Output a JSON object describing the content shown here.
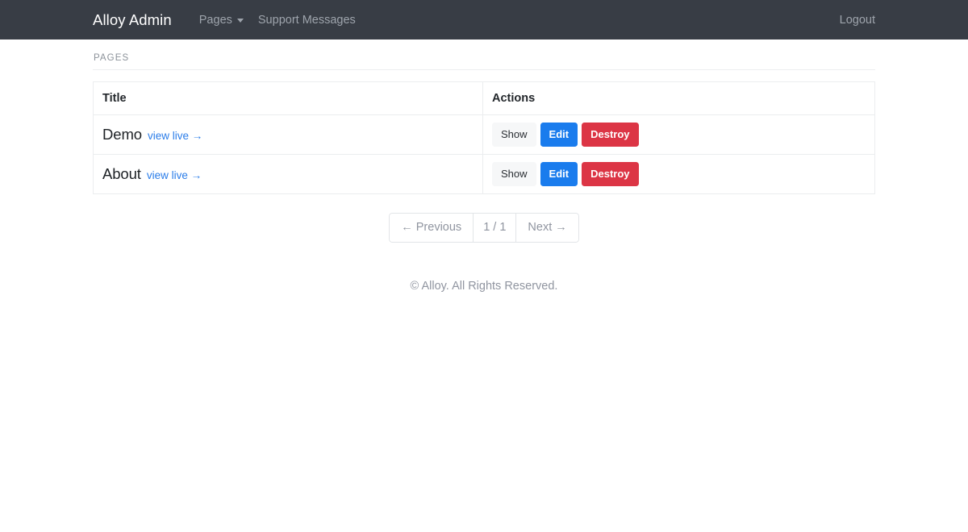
{
  "navbar": {
    "brand": "Alloy Admin",
    "items": [
      {
        "label": "Pages",
        "icon": "chevron-down-icon",
        "has_caret": true
      },
      {
        "label": "Support Messages",
        "has_caret": false
      }
    ],
    "logout_label": "Logout",
    "background_color": "#383d45",
    "text_color": "#9ea4ac"
  },
  "main": {
    "section_title": "PAGES",
    "table": {
      "headers": [
        "Title",
        "Actions"
      ],
      "rows": [
        {
          "title": "Demo",
          "view_live_label": "view live →",
          "actions": [
            {
              "label": "Show",
              "style": "show"
            },
            {
              "label": "Edit",
              "style": "edit"
            },
            {
              "label": "Destroy",
              "style": "destroy"
            }
          ]
        },
        {
          "title": "About",
          "view_live_label": "view live →",
          "actions": [
            {
              "label": "Show",
              "style": "show"
            },
            {
              "label": "Edit",
              "style": "edit"
            },
            {
              "label": "Destroy",
              "style": "destroy"
            }
          ]
        }
      ]
    },
    "pagination": {
      "previous_label": "← Previous",
      "indicator": "1 / 1",
      "next_label": "Next →"
    }
  },
  "footer": {
    "text": "© Alloy. All Rights Reserved."
  },
  "colors": {
    "link_blue": "#2b7de9",
    "edit_blue": "#1a7ced",
    "destroy_red": "#dc3545",
    "show_gray": "#f6f7f8",
    "muted_text": "#9095a0"
  }
}
